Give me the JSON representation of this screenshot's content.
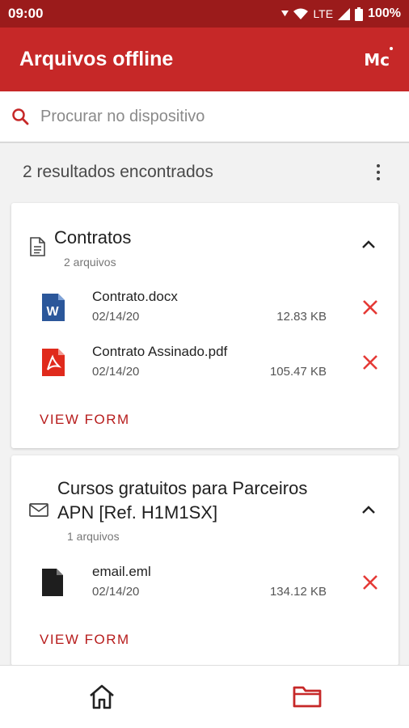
{
  "status_bar": {
    "time": "09:00",
    "network": "LTE",
    "battery": "100%"
  },
  "app_bar": {
    "title": "Arquivos offline",
    "logo_text": "Mc"
  },
  "search": {
    "placeholder": "Procurar no dispositivo",
    "value": ""
  },
  "results": {
    "count_label": "2 resultados encontrados"
  },
  "groups": [
    {
      "title": "Contratos",
      "subtitle": "2 arquivos",
      "icon": "document-icon",
      "files": [
        {
          "name": "Contrato.docx",
          "date": "02/14/20",
          "size": "12.83 KB",
          "type": "word-icon"
        },
        {
          "name": "Contrato Assinado.pdf",
          "date": "02/14/20",
          "size": "105.47 KB",
          "type": "pdf-icon"
        }
      ],
      "action": "VIEW FORM"
    },
    {
      "title_line1": "Cursos gratuitos para Parceiros",
      "title_line2": "APN [Ref. H1M1SX]",
      "subtitle": "1 arquivos",
      "icon": "envelope-icon",
      "files": [
        {
          "name": "email.eml",
          "date": "02/14/20",
          "size": "134.12 KB",
          "type": "generic-file-icon"
        }
      ],
      "action": "VIEW FORM"
    }
  ],
  "bottom_nav": {
    "items": [
      "home-icon",
      "folder-icon"
    ]
  },
  "colors": {
    "status_bar": "#9b1b1b",
    "app_bar": "#c62828",
    "accent": "#c62828",
    "delete": "#e53935",
    "word": "#2b579a",
    "pdf": "#e02a1c"
  }
}
